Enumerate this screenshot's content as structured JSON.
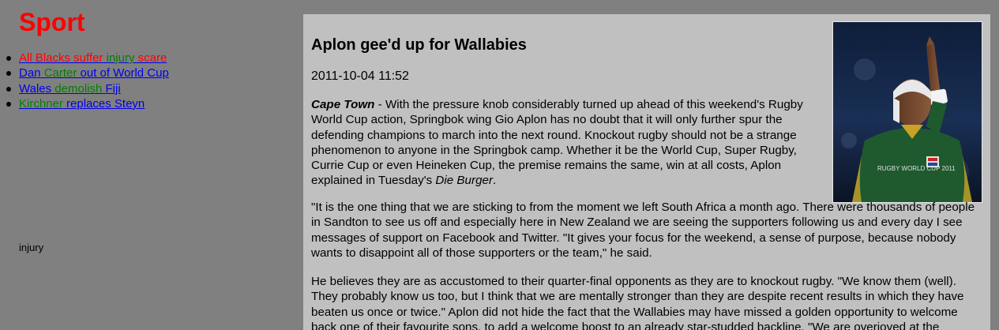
{
  "sidebar": {
    "title": "Sport",
    "headlines": [
      [
        {
          "text": "All Blacks suffer",
          "color": "#ff0000"
        },
        {
          "text": " injury",
          "color": "#008000"
        },
        {
          "text": " scare",
          "color": "#ff0000"
        }
      ],
      [
        {
          "text": "Dan",
          "color": "#0000ee"
        },
        {
          "text": " Carter",
          "color": "#008000"
        },
        {
          "text": " out of World Cup",
          "color": "#0000ee"
        }
      ],
      [
        {
          "text": "Wales",
          "color": "#0000ee"
        },
        {
          "text": " demolish",
          "color": "#008000"
        },
        {
          "text": " Fiji",
          "color": "#0000ee"
        }
      ],
      [
        {
          "text": "Kirchner",
          "color": "#008000"
        },
        {
          "text": " replaces Steyn",
          "color": "#0000ee"
        }
      ]
    ],
    "tag_label": "injury"
  },
  "article": {
    "title": "Aplon gee'd up for Wallabies",
    "date": "2011-10-04 11:52",
    "p1": {
      "dateline": "Cape Town",
      "text_a": " - With the pressure knob considerably turned up ahead of this weekend's Rugby World Cup action, Springbok wing Gio Aplon has no doubt that it will only further spur the defending champions to march into the next round. Knockout rugby should not be a strange phenomenon to anyone in the Springbok camp. Whether it be the World Cup, Super Rugby, Currie Cup or even Heineken Cup, the premise remains the same, win at all costs, Aplon explained in Tuesday's ",
      "source": "Die Burger",
      "text_b": "."
    },
    "p2": "\"It is the one thing that we are sticking to from the moment we left South Africa a month ago. There were thousands of people in Sandton to see us off and especially here in New Zealand we are seeing the supporters following us and every day I see messages of support on Facebook and Twitter. \"It gives your focus for the weekend, a sense of purpose, because nobody wants to disappoint all of those supporters or the team,\" he said.",
    "p3": "He believes they are as accustomed to their quarter-final opponents as they are to knockout rugby. \"We know them (well). They probably know us too, but I think that we are mentally stronger than they are despite recent results in which they have beaten us once or twice.\" Aplon did not hide the fact that the Wallabies may have missed a golden opportunity to welcome back one of their favourite sons, to add a welcome boost to an already star-studded backline. \"We are overjoyed at the",
    "photo_text": "RUGBY WORLD CUP 2011"
  },
  "colors": {
    "page_bg": "#808080",
    "article_bg": "#c0c0c0",
    "title": "#ff0000",
    "link_blue": "#0000ee",
    "link_green": "#008000"
  }
}
